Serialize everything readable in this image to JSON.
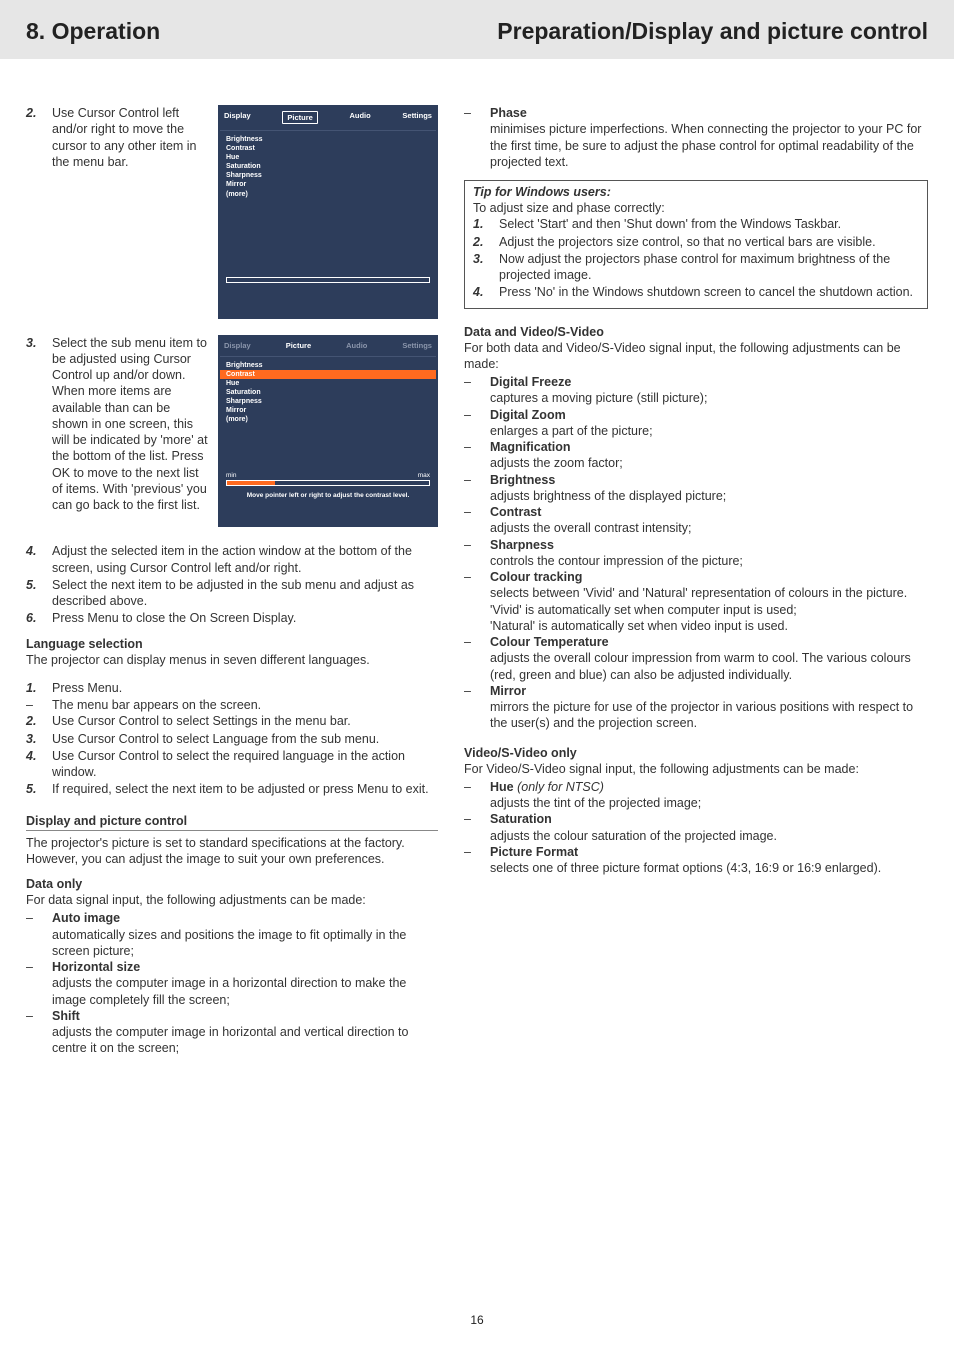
{
  "header": {
    "left": "8. Operation",
    "right": "Preparation/Display and picture control"
  },
  "page_number": "16",
  "left": {
    "step2_text": "Use Cursor Control left and/or right to move the cursor to any other item in the menu bar.",
    "step3_text": "Select the sub menu item to be adjusted using Cursor Control up and/or down. When more items are available than can be shown in one screen, this will be indicated by 'more' at the bottom of the list. Press OK to move to the next list of items. With 'previous' you can go back to the first list.",
    "step4_text": "Adjust the selected item in the action window at the bottom of the screen, using Cursor Control left and/or right.",
    "step5_text": "Select the next item to be adjusted in the sub menu and adjust as described above.",
    "step6_text": "Press Menu to close the On Screen Display.",
    "lang_sel_h": "Language selection",
    "lang_sel_p": "The projector can display menus in seven different languages.",
    "lang_steps": {
      "s1": "Press Menu.",
      "s1_dash": "The menu bar appears on the screen.",
      "s2": "Use Cursor Control to select Settings in the menu bar.",
      "s3": "Use Cursor Control to select Language from the sub menu.",
      "s4": "Use Cursor Control to select the required language in the action window.",
      "s5": "If required, select the next item to be adjusted or press Menu to exit."
    },
    "dpc_h": "Display and picture control",
    "dpc_p": "The projector's picture is set to standard specifications at the factory. However, you can adjust the image to suit your own preferences.",
    "data_only_h": "Data only",
    "data_only_p": "For data signal input, the following adjustments can be made:",
    "data_only_items": {
      "auto_image_t": "Auto image",
      "auto_image_d": "automatically sizes and positions the image to fit optimally in the screen picture;",
      "hsize_t": "Horizontal size",
      "hsize_d": "adjusts the computer image in a horizontal direction to make the image completely fill the screen;",
      "shift_t": "Shift",
      "shift_d": "adjusts the computer image in horizontal and vertical direction to centre it on the screen;"
    }
  },
  "right": {
    "phase_t": "Phase",
    "phase_d": "minimises picture imperfections. When connecting the projector to your PC for the first time, be sure to adjust the phase control for optimal readability of the projected text.",
    "tip_title": "Tip for Windows users:",
    "tip_intro": "To adjust size and phase correctly:",
    "tip_s1": "Select 'Start' and then 'Shut down' from the Windows Taskbar.",
    "tip_s2": "Adjust the projectors size control, so that no vertical bars are visible.",
    "tip_s3": "Now adjust the projectors phase control for maximum brightness of the projected image.",
    "tip_s4": "Press 'No' in the Windows shutdown screen to cancel the shutdown action.",
    "dvsv_h": "Data and Video/S-Video",
    "dvsv_p": "For both data and Video/S-Video signal input, the following adjustments can be made:",
    "dvsv": {
      "dfreeze_t": "Digital Freeze",
      "dfreeze_d": "captures a moving picture (still picture);",
      "dzoom_t": "Digital Zoom",
      "dzoom_d": "enlarges a part of the picture;",
      "mag_t": "Magnification",
      "mag_d": "adjusts the zoom factor;",
      "bright_t": "Brightness",
      "bright_d": "adjusts brightness of the displayed picture;",
      "contrast_t": "Contrast",
      "contrast_d": "adjusts the overall contrast intensity;",
      "sharp_t": "Sharpness",
      "sharp_d": "controls the contour impression of the picture;",
      "ctrack_t": "Colour tracking",
      "ctrack_d1": "selects between 'Vivid' and 'Natural' representation of colours in the picture.",
      "ctrack_d2": "'Vivid' is automatically set when computer input is used;",
      "ctrack_d3": "'Natural' is automatically set when video input is used.",
      "ctemp_t": "Colour Temperature",
      "ctemp_d": "adjusts the overall colour impression from warm to cool. The various colours (red, green and blue) can also be adjusted individually.",
      "mirror_t": "Mirror",
      "mirror_d": "mirrors the picture for use of the projector in various positions with respect to the user(s) and the projection screen."
    },
    "vsv_h": "Video/S-Video only",
    "vsv_p": "For Video/S-Video signal input, the following adjustments can be made:",
    "vsv": {
      "hue_t": "Hue",
      "hue_note": "(only for NTSC)",
      "hue_d": "adjusts the tint of the projected image;",
      "sat_t": "Saturation",
      "sat_d": "adjusts the colour saturation of the projected image.",
      "pf_t": "Picture Format",
      "pf_d": "selects one of three picture format options (4:3, 16:9 or 16:9 enlarged)."
    }
  },
  "osd1": {
    "tab_display": "Display",
    "tab_picture": "Picture",
    "tab_audio": "Audio",
    "tab_settings": "Settings",
    "items": [
      "Brightness",
      "Contrast",
      "Hue",
      "Saturation",
      "Sharpness",
      "Mirror",
      "(more)"
    ]
  },
  "osd2": {
    "tab_display": "Display",
    "tab_picture": "Picture",
    "tab_audio": "Audio",
    "tab_settings": "Settings",
    "items": [
      "Brightness",
      "Contrast",
      "Hue",
      "Saturation",
      "Sharpness",
      "Mirror",
      "(more)"
    ],
    "min": "min",
    "max": "max",
    "hint": "Move pointer left or right to adjust the contrast level."
  }
}
